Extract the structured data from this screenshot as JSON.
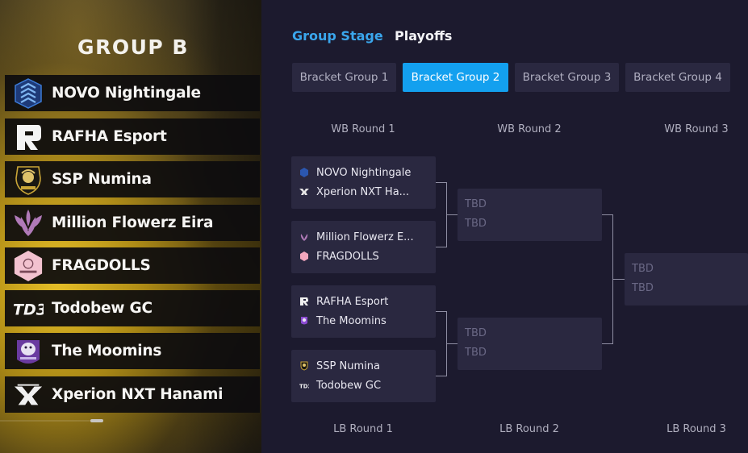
{
  "left_panel": {
    "group_title": "GROUP B",
    "teams": [
      {
        "name": "NOVO Nightingale",
        "icon": "novo-logo-icon"
      },
      {
        "name": "RAFHA Esport",
        "icon": "rafha-logo-icon"
      },
      {
        "name": "SSP Numina",
        "icon": "ssp-logo-icon"
      },
      {
        "name": "Million Flowerz Eira",
        "icon": "million-flowerz-logo-icon"
      },
      {
        "name": "FRAGDOLLS",
        "icon": "fragdolls-logo-icon"
      },
      {
        "name": "Todobew GC",
        "icon": "todobew-logo-icon"
      },
      {
        "name": "The Moomins",
        "icon": "moomins-logo-icon"
      },
      {
        "name": "Xperion NXT Hanami",
        "icon": "xperion-logo-icon"
      }
    ]
  },
  "tabs": {
    "group_stage": "Group Stage",
    "playoffs": "Playoffs",
    "active": "group_stage"
  },
  "bracket_groups": [
    {
      "label": "Bracket Group 1",
      "active": false
    },
    {
      "label": "Bracket Group 2",
      "active": true
    },
    {
      "label": "Bracket Group 3",
      "active": false
    },
    {
      "label": "Bracket Group 4",
      "active": false
    }
  ],
  "rounds": {
    "wb": [
      "WB Round 1",
      "WB Round 2",
      "WB Round 3"
    ],
    "lb": [
      "LB Round 1",
      "LB Round 2",
      "LB Round 3"
    ]
  },
  "wb_round1": [
    {
      "team1": "NOVO Nightingale",
      "team2": "Xperion NXT Ha..."
    },
    {
      "team1": "Million Flowerz E...",
      "team2": "FRAGDOLLS"
    },
    {
      "team1": "RAFHA Esport",
      "team2": "The Moomins"
    },
    {
      "team1": "SSP Numina",
      "team2": "Todobew GC"
    }
  ],
  "tbd": "TBD",
  "colors": {
    "accent": "#13a0ef",
    "tab_active": "#3aa6ec",
    "panel_bg": "#1c1a2e",
    "card_bg": "#2a2840"
  }
}
